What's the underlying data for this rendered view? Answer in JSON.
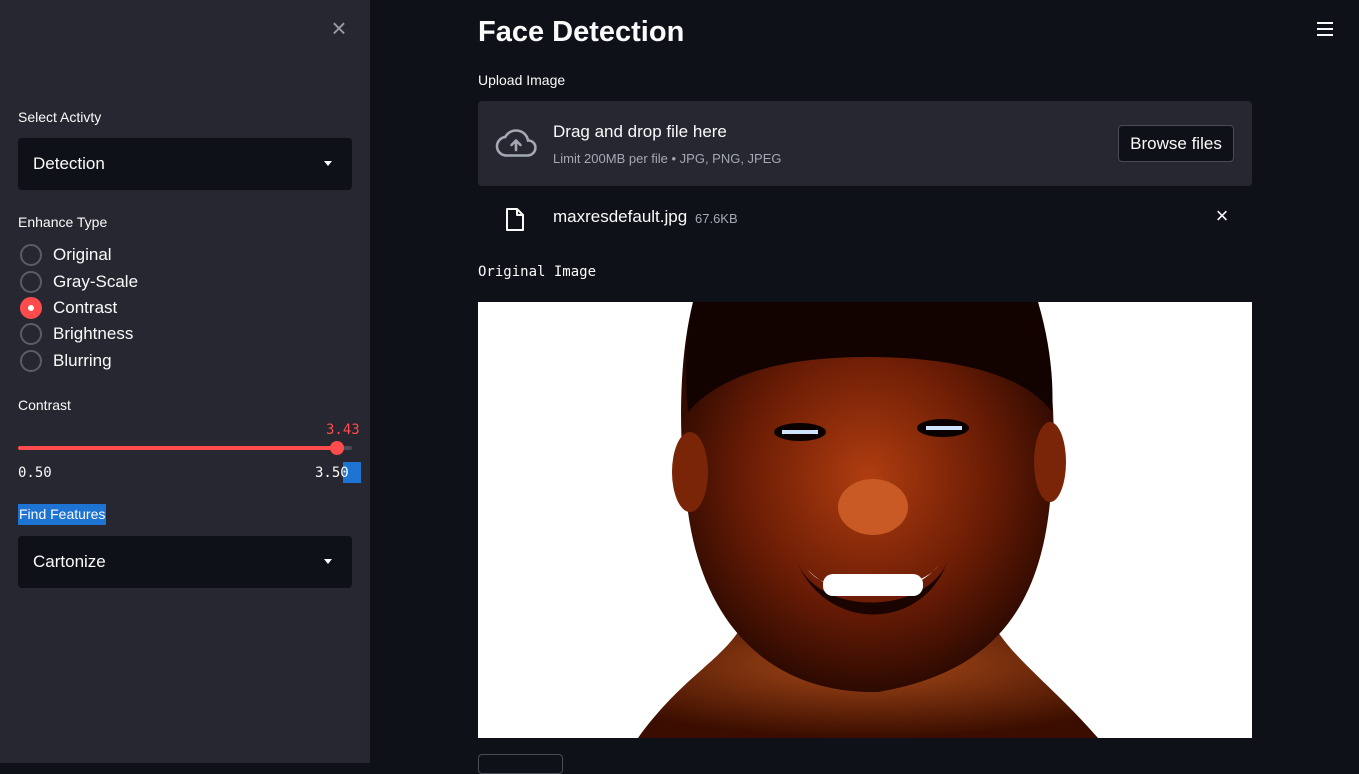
{
  "sidebar": {
    "close_icon": "close-icon",
    "activity_label": "Select Activty",
    "activity_value": "Detection",
    "enhance_label": "Enhance Type",
    "enhance_options": [
      {
        "label": "Original",
        "checked": false
      },
      {
        "label": "Gray-Scale",
        "checked": false
      },
      {
        "label": "Contrast",
        "checked": true
      },
      {
        "label": "Brightness",
        "checked": false
      },
      {
        "label": "Blurring",
        "checked": false
      }
    ],
    "contrast_label": "Contrast",
    "contrast_slider": {
      "value": "3.43",
      "min": "0.50",
      "max": "3.50"
    },
    "features_label": "Find Features",
    "features_value": "Cartonize"
  },
  "main": {
    "title": "Face Detection",
    "upload_label": "Upload Image",
    "dropzone": {
      "title": "Drag and drop file here",
      "subtitle": "Limit 200MB per file • JPG, PNG, JPEG",
      "browse_label": "Browse files"
    },
    "file": {
      "name": "maxresdefault.jpg",
      "size": "67.6KB"
    },
    "image_caption": "Original Image"
  },
  "colors": {
    "accent": "#ff4b4b",
    "sidebar_bg": "#262730",
    "main_bg": "#0e1117",
    "highlight": "#1e74d2"
  }
}
